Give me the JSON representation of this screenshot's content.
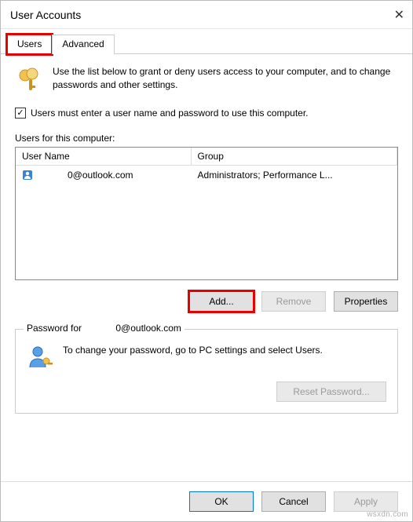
{
  "window": {
    "title": "User Accounts"
  },
  "tabs": {
    "users": "Users",
    "advanced": "Advanced"
  },
  "intro": "Use the list below to grant or deny users access to your computer, and to change passwords and other settings.",
  "checkbox": {
    "checked": true,
    "label": "Users must enter a user name and password to use this computer."
  },
  "users_section_label": "Users for this computer:",
  "columns": {
    "user": "User Name",
    "group": "Group"
  },
  "rows": [
    {
      "user_prefix": "",
      "user_redacted": "········",
      "user_suffix": "0@outlook.com",
      "group": "Administrators; Performance L..."
    }
  ],
  "buttons": {
    "add": "Add...",
    "remove": "Remove",
    "properties": "Properties",
    "reset_pw": "Reset Password...",
    "ok": "OK",
    "cancel": "Cancel",
    "apply": "Apply"
  },
  "password_box": {
    "legend_prefix": "Password for ",
    "legend_redacted": "······",
    "legend_suffix": "0@outlook.com",
    "text": "To change your password, go to PC settings and select Users."
  },
  "watermark": "wsxdn.com"
}
